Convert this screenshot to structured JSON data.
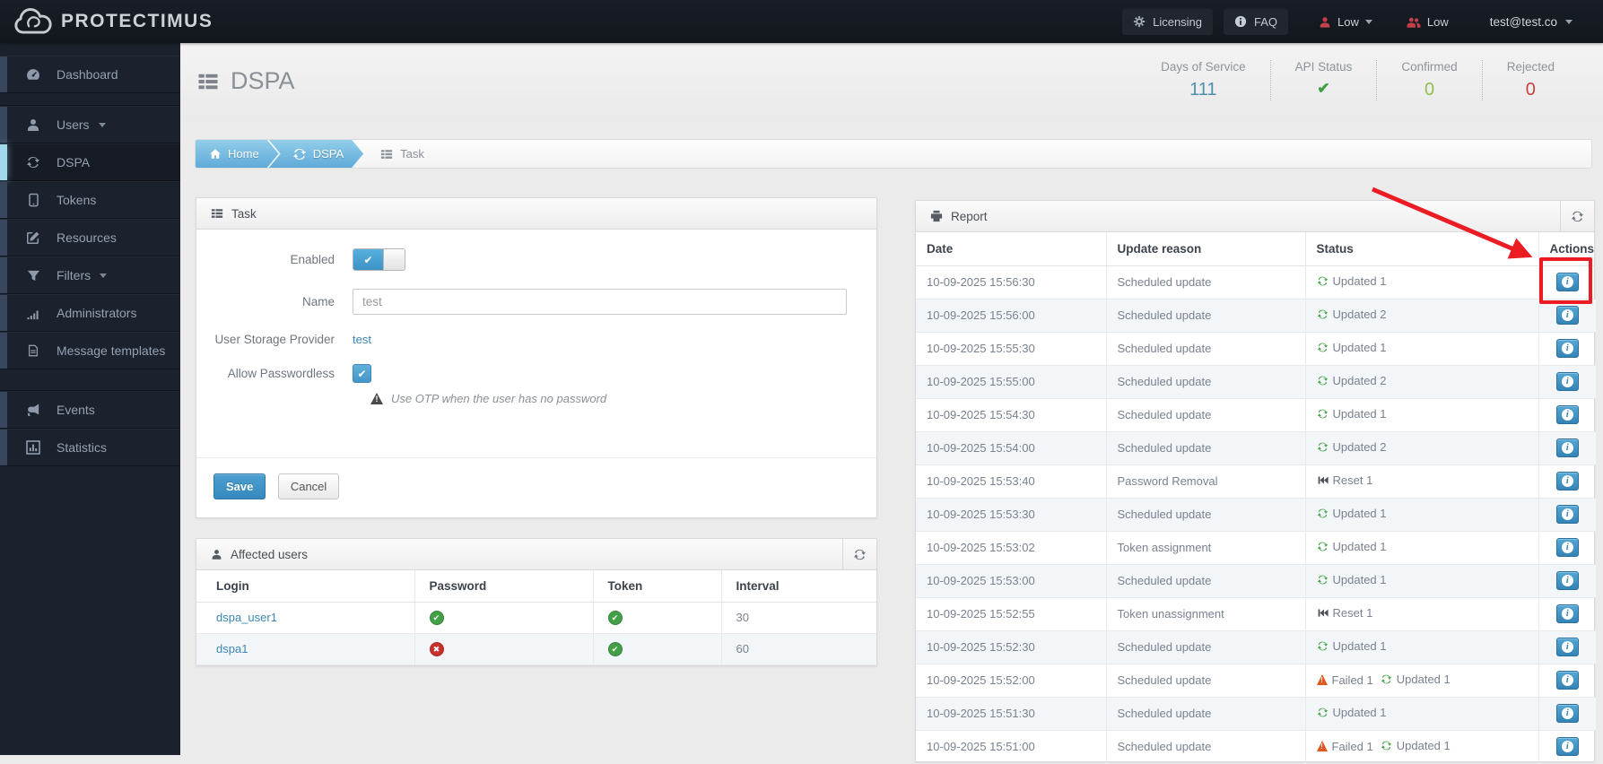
{
  "navbar": {
    "brand": "PROTECTIMUS",
    "licensing": "Licensing",
    "faq": "FAQ",
    "alert_user": "Low",
    "alert_users": "Low",
    "account": "test@test.co"
  },
  "sidebar": {
    "groups": [
      {
        "items": [
          {
            "label": "Dashboard",
            "icon": "dashboard-icon"
          }
        ]
      },
      {
        "items": [
          {
            "label": "Users",
            "icon": "user-icon",
            "caret": true
          },
          {
            "label": "DSPA",
            "icon": "refresh-icon",
            "active": true
          },
          {
            "label": "Tokens",
            "icon": "tablet-icon"
          },
          {
            "label": "Resources",
            "icon": "edit-icon"
          },
          {
            "label": "Filters",
            "icon": "filter-icon",
            "caret": true
          },
          {
            "label": "Administrators",
            "icon": "signal-icon"
          },
          {
            "label": "Message templates",
            "icon": "file-icon"
          }
        ]
      },
      {
        "items": [
          {
            "label": "Events",
            "icon": "bullhorn-icon"
          },
          {
            "label": "Statistics",
            "icon": "chart-icon"
          }
        ]
      }
    ]
  },
  "header": {
    "title": "DSPA",
    "stats": [
      {
        "label": "Days of Service",
        "value": "111",
        "type": "text",
        "color": "#4e8fae"
      },
      {
        "label": "API Status",
        "value": "",
        "type": "check",
        "color": "#3f9e3f"
      },
      {
        "label": "Confirmed",
        "value": "0",
        "type": "text",
        "color": "#8fbf4d"
      },
      {
        "label": "Rejected",
        "value": "0",
        "type": "text",
        "color": "#c9413c"
      }
    ]
  },
  "breadcrumb": [
    {
      "label": "Home",
      "icon": "home-icon",
      "style": "tab"
    },
    {
      "label": "DSPA",
      "icon": "refresh-icon",
      "style": "tab"
    },
    {
      "label": "Task",
      "icon": "list-icon",
      "style": "plain"
    }
  ],
  "task": {
    "title": "Task",
    "enabled_label": "Enabled",
    "name_label": "Name",
    "name_value": "test",
    "provider_label": "User Storage Provider",
    "provider_value": "test",
    "passwordless_label": "Allow Passwordless",
    "passwordless_hint": "Use OTP when the user has no password",
    "save": "Save",
    "cancel": "Cancel"
  },
  "affected": {
    "title": "Affected users",
    "columns": [
      "Login",
      "Password",
      "Token",
      "Interval"
    ],
    "rows": [
      {
        "login": "dspa_user1",
        "password": "ok",
        "token": "ok",
        "interval": "30"
      },
      {
        "login": "dspa1",
        "password": "fail",
        "token": "ok",
        "interval": "60"
      }
    ]
  },
  "report": {
    "title": "Report",
    "columns": [
      "Date",
      "Update reason",
      "Status",
      "Actions"
    ],
    "rows": [
      {
        "date": "10-09-2025 15:56:30",
        "reason": "Scheduled update",
        "status": [
          {
            "icon": "refresh-icon",
            "label": "Updated 1"
          }
        ]
      },
      {
        "date": "10-09-2025 15:56:00",
        "reason": "Scheduled update",
        "status": [
          {
            "icon": "refresh-icon",
            "label": "Updated 2"
          }
        ]
      },
      {
        "date": "10-09-2025 15:55:30",
        "reason": "Scheduled update",
        "status": [
          {
            "icon": "refresh-icon",
            "label": "Updated 1"
          }
        ]
      },
      {
        "date": "10-09-2025 15:55:00",
        "reason": "Scheduled update",
        "status": [
          {
            "icon": "refresh-icon",
            "label": "Updated 2"
          }
        ]
      },
      {
        "date": "10-09-2025 15:54:30",
        "reason": "Scheduled update",
        "status": [
          {
            "icon": "refresh-icon",
            "label": "Updated 1"
          }
        ]
      },
      {
        "date": "10-09-2025 15:54:00",
        "reason": "Scheduled update",
        "status": [
          {
            "icon": "refresh-icon",
            "label": "Updated 2"
          }
        ]
      },
      {
        "date": "10-09-2025 15:53:40",
        "reason": "Password Removal",
        "status": [
          {
            "icon": "fast-backward-icon",
            "label": "Reset 1"
          }
        ]
      },
      {
        "date": "10-09-2025 15:53:30",
        "reason": "Scheduled update",
        "status": [
          {
            "icon": "refresh-icon",
            "label": "Updated 1"
          }
        ]
      },
      {
        "date": "10-09-2025 15:53:02",
        "reason": "Token assignment",
        "status": [
          {
            "icon": "refresh-icon",
            "label": "Updated 1"
          }
        ]
      },
      {
        "date": "10-09-2025 15:53:00",
        "reason": "Scheduled update",
        "status": [
          {
            "icon": "refresh-icon",
            "label": "Updated 1"
          }
        ]
      },
      {
        "date": "10-09-2025 15:52:55",
        "reason": "Token unassignment",
        "status": [
          {
            "icon": "fast-backward-icon",
            "label": "Reset 1"
          }
        ]
      },
      {
        "date": "10-09-2025 15:52:30",
        "reason": "Scheduled update",
        "status": [
          {
            "icon": "refresh-icon",
            "label": "Updated 1"
          }
        ]
      },
      {
        "date": "10-09-2025 15:52:00",
        "reason": "Scheduled update",
        "status": [
          {
            "icon": "warning-icon",
            "label": "Failed 1"
          },
          {
            "icon": "refresh-icon",
            "label": "Updated 1"
          }
        ]
      },
      {
        "date": "10-09-2025 15:51:30",
        "reason": "Scheduled update",
        "status": [
          {
            "icon": "refresh-icon",
            "label": "Updated 1"
          }
        ]
      },
      {
        "date": "10-09-2025 15:51:00",
        "reason": "Scheduled update",
        "status": [
          {
            "icon": "warning-icon",
            "label": "Failed 1"
          },
          {
            "icon": "refresh-icon",
            "label": "Updated 1"
          }
        ]
      }
    ]
  },
  "annotation": {
    "color": "#ec1c24",
    "target": "first report actions info button"
  }
}
